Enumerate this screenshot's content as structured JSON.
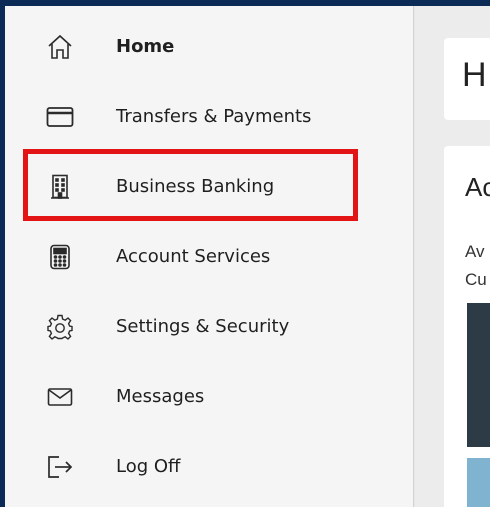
{
  "nav": {
    "items": [
      {
        "label": "Home",
        "icon": "home-icon"
      },
      {
        "label": "Transfers & Payments",
        "icon": "credit-card-icon"
      },
      {
        "label": "Business Banking",
        "icon": "building-icon"
      },
      {
        "label": "Account Services",
        "icon": "calculator-icon"
      },
      {
        "label": "Settings & Security",
        "icon": "gear-icon"
      },
      {
        "label": "Messages",
        "icon": "envelope-icon"
      },
      {
        "label": "Log Off",
        "icon": "logout-icon"
      }
    ]
  },
  "main": {
    "header_text": "H",
    "card_title": "Ac",
    "line1": "Av",
    "line2": "Cu"
  },
  "colors": {
    "border": "#0b2a55",
    "highlight": "#e31414",
    "bar_dark": "#2d3b47",
    "bar_light": "#7fb3cf"
  }
}
